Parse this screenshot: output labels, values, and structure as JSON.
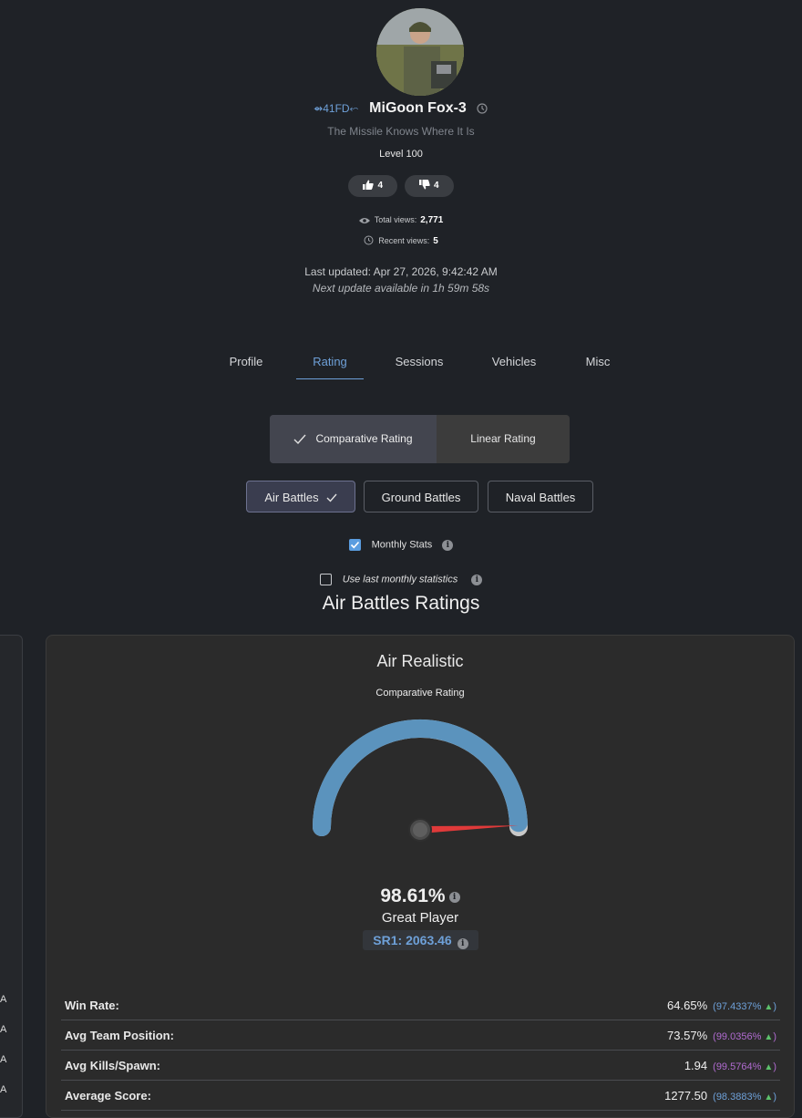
{
  "profile": {
    "clan_tag": "41FD",
    "name": "MiGoon Fox-3",
    "motto": "The Missile Knows Where It Is",
    "level": "Level 100",
    "likes": "4",
    "dislikes": "4",
    "total_views_label": "Total views:",
    "total_views": "2,771",
    "recent_views_label": "Recent views:",
    "recent_views": "5",
    "last_updated": "Last updated: Apr 27, 2026, 9:42:42 AM",
    "next_update": "Next update available in 1h 59m 58s"
  },
  "tabs": [
    {
      "label": "Profile"
    },
    {
      "label": "Rating",
      "active": true
    },
    {
      "label": "Sessions"
    },
    {
      "label": "Vehicles"
    },
    {
      "label": "Misc"
    }
  ],
  "rating_mode": {
    "comparative": "Comparative Rating",
    "linear": "Linear Rating",
    "selected": "comparative"
  },
  "battle_types": [
    {
      "label": "Air Battles",
      "active": true
    },
    {
      "label": "Ground Battles"
    },
    {
      "label": "Naval Battles"
    }
  ],
  "options": {
    "monthly_stats": "Monthly Stats",
    "monthly_checked": true,
    "last_monthly": "Use last monthly statistics",
    "last_monthly_checked": false
  },
  "section_title": "Air Battles Ratings",
  "left_card_rows": [
    "A",
    "A",
    "A",
    "A"
  ],
  "card": {
    "title": "Air Realistic",
    "subtitle": "Comparative Rating",
    "gauge_fraction": 0.9861,
    "percent": "98.61%",
    "grade": "Great Player",
    "sr": "SR1: 2063.46",
    "stats": [
      {
        "label": "Win Rate:",
        "value": "64.65%",
        "percentile": "97.4337%",
        "pctl_color": "#6ea0d8"
      },
      {
        "label": "Avg Team Position:",
        "value": "73.57%",
        "percentile": "99.0356%",
        "pctl_color": "#b06bd0"
      },
      {
        "label": "Avg Kills/Spawn:",
        "value": "1.94",
        "percentile": "99.5764%",
        "pctl_color": "#b06bd0"
      },
      {
        "label": "Average Score:",
        "value": "1277.50",
        "percentile": "98.3883%",
        "pctl_color": "#6ea0d8"
      }
    ]
  },
  "colors": {
    "accent": "#6ea0d8",
    "gauge_arc": "#5b93bd",
    "needle": "#e03a3a"
  }
}
